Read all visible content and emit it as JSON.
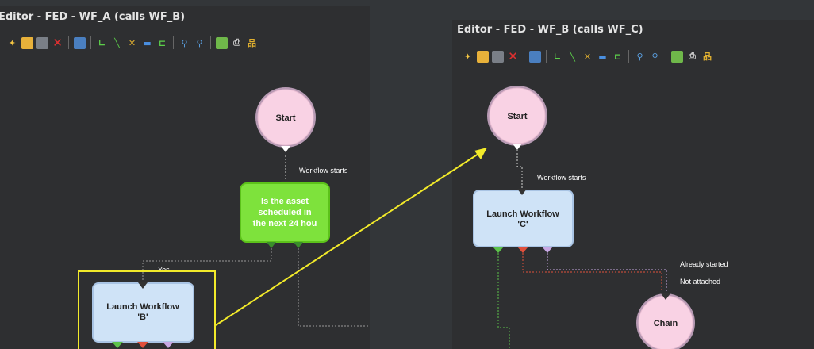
{
  "panels": [
    {
      "title": "Editor - FED - WF_A (calls WF_B)",
      "nodes": {
        "start": "Start",
        "decision_line1": "Is the asset",
        "decision_line2": "scheduled in",
        "decision_line3": "the next 24 hou",
        "launch_line1": "Launch Workflow",
        "launch_line2": "'B'"
      },
      "edge_labels": {
        "workflow_starts": "Workflow starts",
        "yes": "Yes"
      }
    },
    {
      "title": "Editor - FED - WF_B (calls WF_C)",
      "nodes": {
        "start": "Start",
        "launch_line1": "Launch Workflow",
        "launch_line2": "'C'",
        "chain": "Chain"
      },
      "edge_labels": {
        "workflow_starts": "Workflow starts",
        "already_started": "Already started",
        "not_attached": "Not attached"
      }
    }
  ],
  "toolbar": [
    {
      "icon": "new-workflow-icon"
    },
    {
      "icon": "open-folder-icon"
    },
    {
      "icon": "save-disk-icon"
    },
    {
      "icon": "delete-x-icon"
    },
    {
      "icon": "copy-icon"
    },
    {
      "icon": "elbow-connector-icon"
    },
    {
      "icon": "straight-connector-icon"
    },
    {
      "icon": "remove-connector-icon"
    },
    {
      "icon": "rectangle-icon"
    },
    {
      "icon": "auto-layout-icon"
    },
    {
      "icon": "zoom-in-icon"
    },
    {
      "icon": "zoom-out-icon"
    },
    {
      "icon": "properties-icon"
    },
    {
      "icon": "print-icon"
    },
    {
      "icon": "hierarchy-icon"
    }
  ],
  "colors": {
    "start_fill": "#f9d2e4",
    "decision_fill": "#7ee23c",
    "launch_fill": "#cfe3f7",
    "highlight": "#f2ea2a",
    "arrow": "#f2ea2a"
  }
}
